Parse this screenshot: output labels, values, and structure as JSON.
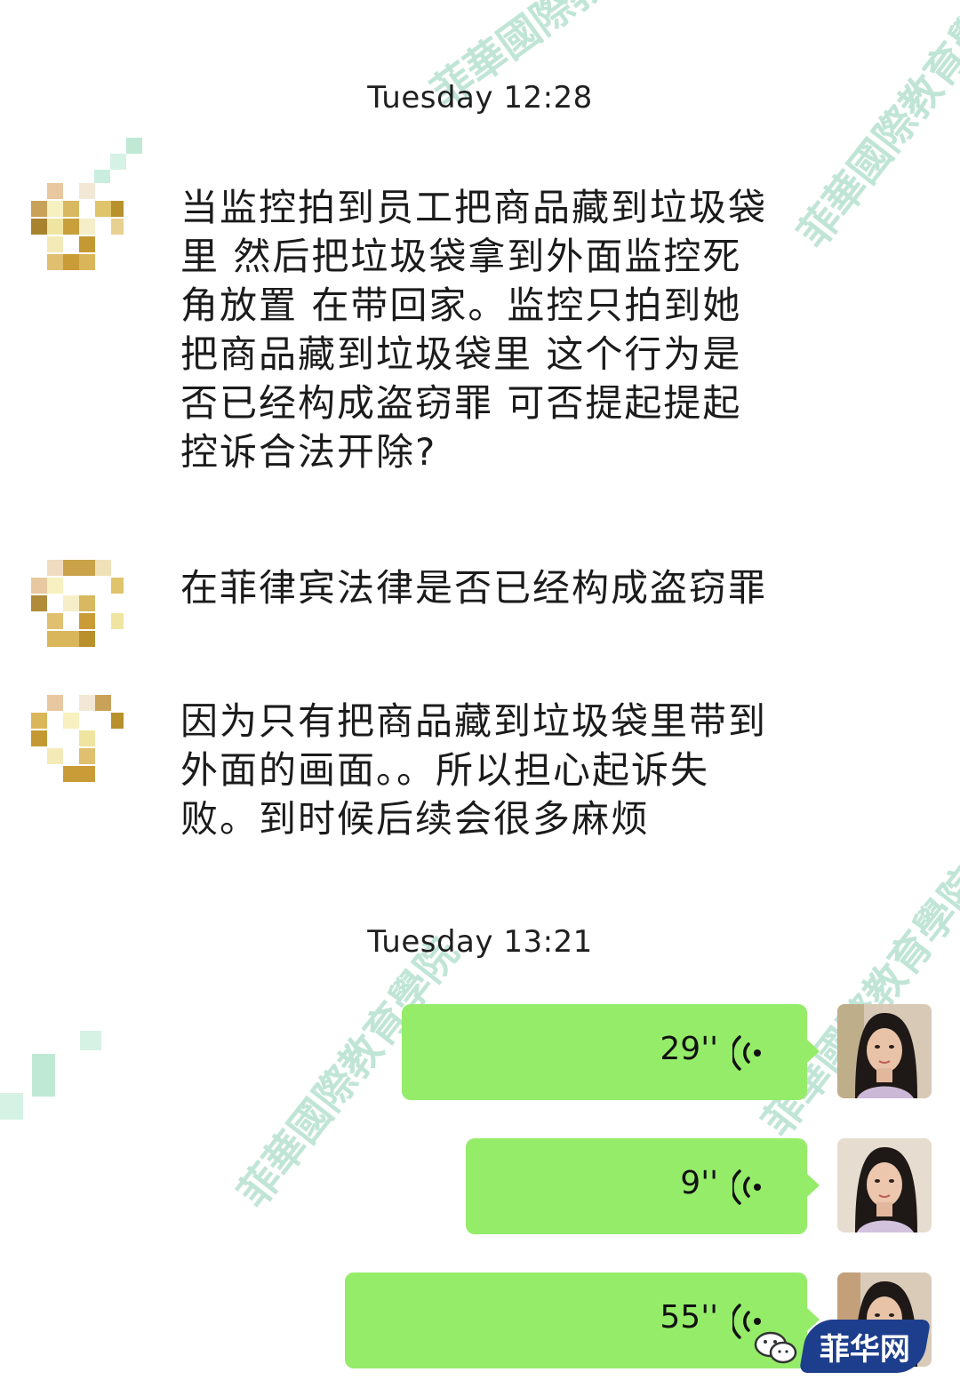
{
  "chat": {
    "timestamps": [
      "Tuesday 12:28",
      "Tuesday 13:21"
    ],
    "incoming_messages": [
      {
        "text": "当监控拍到员工把商品藏到垃圾袋\n里 然后把垃圾袋拿到外面监控死\n角放置 在带回家。监控只拍到她\n把商品藏到垃圾袋里 这个行为是\n否已经构成盗窃罪 可否提起提起\n控诉合法开除?",
        "avatar": "pixelated-avatar"
      },
      {
        "text": "在菲律宾法律是否已经构成盗窃罪",
        "avatar": "pixelated-avatar"
      },
      {
        "text": "因为只有把商品藏到垃圾袋里带到\n外面的画面。。所以担心起诉失\n败。到时候后续会很多麻烦",
        "avatar": "pixelated-avatar"
      }
    ],
    "voice_messages": [
      {
        "duration": "29''",
        "icon": "voice-wave-icon"
      },
      {
        "duration": "9''",
        "icon": "voice-wave-icon"
      },
      {
        "duration": "55''",
        "icon": "voice-wave-icon"
      }
    ]
  },
  "watermark": {
    "text_full": "菲華國際教育學院",
    "color": "#3caf82"
  },
  "logo": {
    "text": "菲华网",
    "color": "#1d3e8c",
    "icon": "wechat-icon"
  },
  "colors": {
    "bubble_out": "#95ec69",
    "background": "#ffffff"
  }
}
